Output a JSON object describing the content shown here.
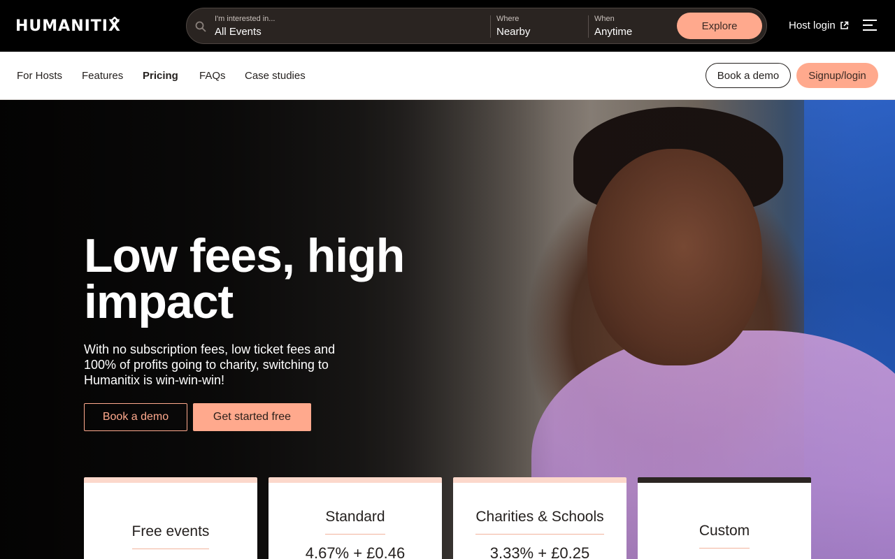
{
  "brand": {
    "logo_text": "HUMANITIX"
  },
  "search": {
    "interest_label": "I'm interested in...",
    "interest_value": "All Events",
    "where_label": "Where",
    "where_value": "Nearby",
    "when_label": "When",
    "when_value": "Anytime",
    "explore_label": "Explore"
  },
  "header": {
    "host_login": "Host login"
  },
  "subnav": {
    "items": [
      "For Hosts",
      "Features",
      "Pricing",
      "FAQs",
      "Case studies"
    ],
    "active": "Pricing",
    "book_demo": "Book a demo",
    "signup": "Signup/login"
  },
  "hero": {
    "title": "Low fees, high impact",
    "subtitle": "With no subscription fees, low ticket fees and 100% of profits going to charity, switching to Humanitix is win-win-win!",
    "book_demo": "Book a demo",
    "get_started": "Get started free"
  },
  "pricing": [
    {
      "title": "Free events",
      "price": ""
    },
    {
      "title": "Standard",
      "price": "4.67% + £0.46"
    },
    {
      "title": "Charities & Schools",
      "price": "3.33% + £0.25"
    },
    {
      "title": "Custom",
      "price": ""
    }
  ],
  "colors": {
    "accent": "#ffa98d",
    "topbar": "#000000",
    "text": "#231f1d"
  }
}
